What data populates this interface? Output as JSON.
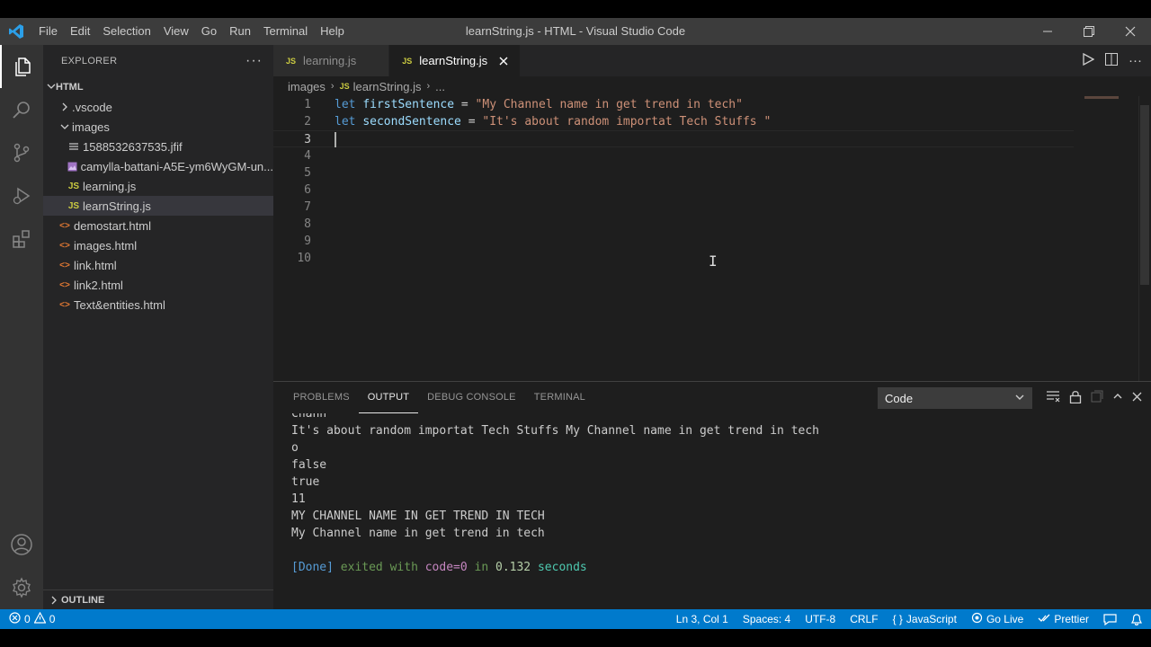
{
  "window": {
    "title": "learnString.js - HTML - Visual Studio Code",
    "menu": [
      "File",
      "Edit",
      "Selection",
      "View",
      "Go",
      "Run",
      "Terminal",
      "Help"
    ]
  },
  "sidebar": {
    "title": "EXPLORER",
    "root": "HTML",
    "items": [
      {
        "label": ".vscode",
        "type": "folder-collapsed"
      },
      {
        "label": "images",
        "type": "folder-open"
      },
      {
        "label": "1588532637535.jfif",
        "type": "image"
      },
      {
        "label": "camylla-battani-A5E-ym6WyGM-un...",
        "type": "image"
      },
      {
        "label": "learning.js",
        "type": "js"
      },
      {
        "label": "learnString.js",
        "type": "js",
        "selected": true
      },
      {
        "label": "demostart.html",
        "type": "html"
      },
      {
        "label": "images.html",
        "type": "html"
      },
      {
        "label": "link.html",
        "type": "html"
      },
      {
        "label": "link2.html",
        "type": "html"
      },
      {
        "label": "Text&entities.html",
        "type": "html"
      }
    ],
    "outline": "OUTLINE"
  },
  "tabs": [
    {
      "label": "learning.js",
      "active": false
    },
    {
      "label": "learnString.js",
      "active": true
    }
  ],
  "breadcrumb": {
    "folder": "images",
    "file": "learnString.js",
    "more": "..."
  },
  "code": {
    "line_numbers": [
      "1",
      "2",
      "3",
      "4",
      "5",
      "6",
      "7",
      "8",
      "9",
      "10"
    ],
    "line1": {
      "kw": "let",
      "var": "firstSentence",
      "op": " = ",
      "str": "\"My Channel name in get trend in tech\""
    },
    "line2": {
      "kw": "let",
      "var": "secondSentence",
      "op": " = ",
      "str": "\"It's about random importat Tech Stuffs \""
    }
  },
  "panel": {
    "tabs": [
      "PROBLEMS",
      "OUTPUT",
      "DEBUG CONSOLE",
      "TERMINAL"
    ],
    "active_tab": "OUTPUT",
    "select_value": "Code",
    "output_lines": [
      "Chann",
      "It's about random importat Tech Stuffs My Channel name in get trend in tech",
      "o",
      "false",
      "true",
      "11",
      "MY CHANNEL NAME IN GET TREND IN TECH",
      "My Channel name in get trend in tech",
      ""
    ],
    "done": {
      "tag": "[Done]",
      "text1": "exited with",
      "kw": "code=0",
      "text2": "in",
      "num": "0.132",
      "text3": "seconds"
    }
  },
  "statusbar": {
    "errors": "0",
    "warnings": "0",
    "position": "Ln 3, Col 1",
    "spaces": "Spaces: 4",
    "encoding": "UTF-8",
    "eol": "CRLF",
    "language": "JavaScript",
    "golive": "Go Live",
    "prettier": "Prettier"
  },
  "colors": {
    "accent": "#007acc",
    "keyword": "#569cd6",
    "variable": "#9cdcfe",
    "string": "#ce9178"
  }
}
